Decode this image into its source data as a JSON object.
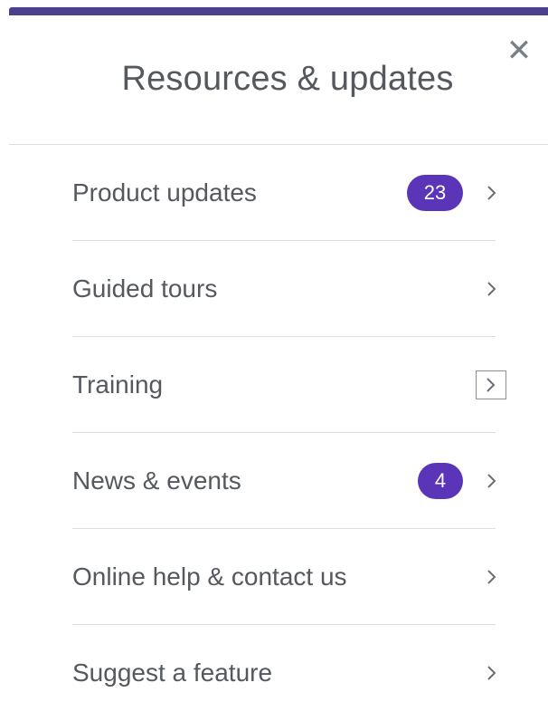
{
  "panel": {
    "title": "Resources & updates",
    "close_icon": "close-icon",
    "accent_color": "#4b3f8f",
    "badge_color": "#5b35b8"
  },
  "menu": {
    "items": [
      {
        "label": "Product updates",
        "badge": "23",
        "icon": "chevron-right-icon"
      },
      {
        "label": "Guided tours",
        "badge": null,
        "icon": "chevron-right-icon"
      },
      {
        "label": "Training",
        "badge": null,
        "icon": "chevron-right-icon",
        "focused": true
      },
      {
        "label": "News & events",
        "badge": "4",
        "icon": "chevron-right-icon"
      },
      {
        "label": "Online help & contact us",
        "badge": null,
        "icon": "chevron-right-icon"
      },
      {
        "label": "Suggest a feature",
        "badge": null,
        "icon": "chevron-right-icon"
      }
    ]
  }
}
